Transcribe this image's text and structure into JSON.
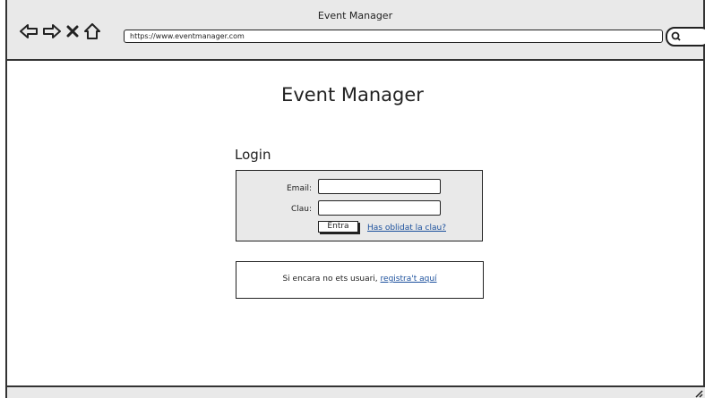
{
  "window": {
    "title": "Event Manager"
  },
  "address_bar": {
    "url": "https://www.eventmanager.com"
  },
  "nav_icons": [
    "back-arrow-icon",
    "forward-arrow-icon",
    "close-x-icon",
    "home-icon"
  ],
  "page": {
    "title": "Event Manager",
    "login": {
      "heading": "Login",
      "email_label": "Email:",
      "password_label": "Clau:",
      "submit_label": "Entra",
      "forgot_link": "Has oblidat la clau?"
    },
    "register": {
      "text": "Si encara no ets usuari,",
      "link": "registra't aquí"
    }
  }
}
